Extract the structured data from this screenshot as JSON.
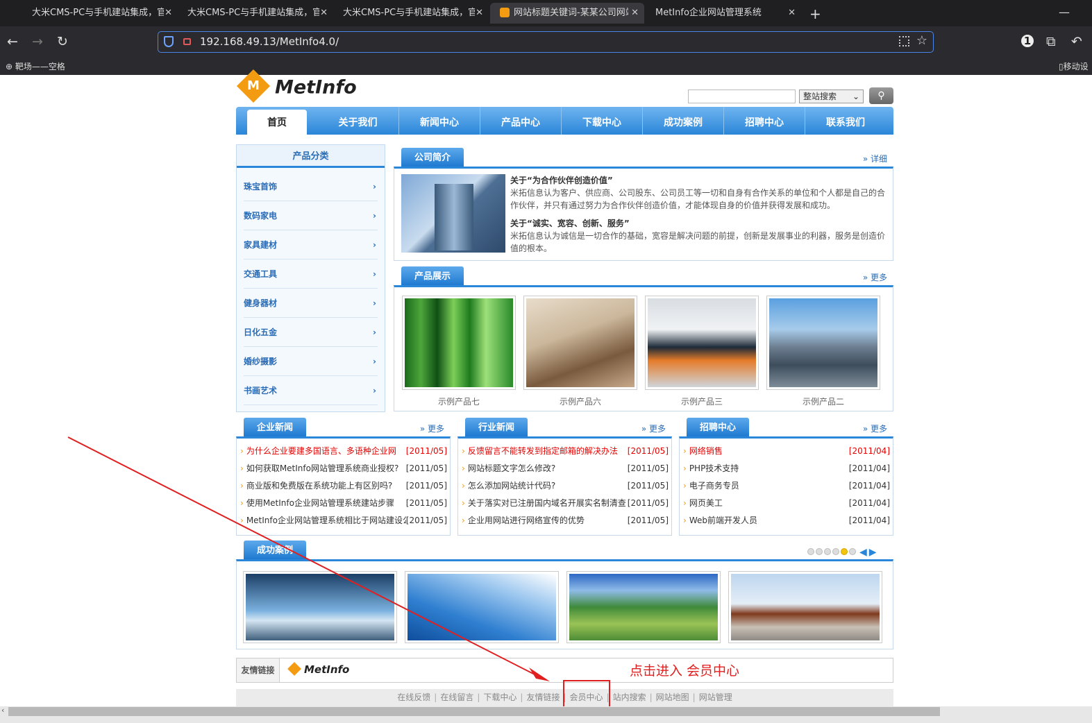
{
  "browser": {
    "tabs": [
      {
        "title": "大米CMS-PC与手机建站集成，官网"
      },
      {
        "title": "大米CMS-PC与手机建站集成，官网"
      },
      {
        "title": "大米CMS-PC与手机建站集成，官网"
      },
      {
        "title": "网站标题关键词-某某公司网站"
      },
      {
        "title": "MetInfo企业网站管理系统"
      }
    ],
    "url": "192.168.49.13/MetInfo4.0/",
    "bookmark": "靶场——空格",
    "bookmark_right": "移动设"
  },
  "site": {
    "logo_text": "MetInfo",
    "logo_letter": "M",
    "search_select": "整站搜索",
    "nav": [
      "首页",
      "关于我们",
      "新闻中心",
      "产品中心",
      "下载中心",
      "成功案例",
      "招聘中心",
      "联系我们"
    ],
    "sidebar": {
      "title": "产品分类",
      "items": [
        "珠宝首饰",
        "数码家电",
        "家具建材",
        "交通工具",
        "健身器材",
        "日化五金",
        "婚纱摄影",
        "书画艺术"
      ]
    },
    "intro": {
      "tab": "公司简介",
      "more": "详细",
      "h1": "关于“为合作伙伴创造价值”",
      "p1": "米拓信息认为客户、供应商、公司股东、公司员工等一切和自身有合作关系的单位和个人都是自己的合作伙伴，并只有通过努力为合作伙伴创造价值，才能体现自身的价值并获得发展和成功。",
      "h2": "关于“诚实、宽容、创新、服务”",
      "p2": "米拓信息认为诚信是一切合作的基础，宽容是解决问题的前提，创新是发展事业的利器，服务是创造价值的根本。"
    },
    "products": {
      "tab": "产品展示",
      "more": "更多",
      "items": [
        "示例产品七",
        "示例产品六",
        "示例产品三",
        "示例产品二"
      ]
    },
    "news_company": {
      "tab": "企业新闻",
      "more": "更多",
      "items": [
        {
          "title": "为什么企业要建多国语言、多语种企业网",
          "date": "[2011/05]",
          "hot": true
        },
        {
          "title": "如何获取MetInfo网站管理系统商业授权?",
          "date": "[2011/05]"
        },
        {
          "title": "商业版和免费版在系统功能上有区别吗?",
          "date": "[2011/05]"
        },
        {
          "title": "使用MetInfo企业网站管理系统建站步骤",
          "date": "[2011/05]"
        },
        {
          "title": "MetInfo企业网站管理系统相比于网站建设公",
          "date": "[2011/05]"
        }
      ]
    },
    "news_industry": {
      "tab": "行业新闻",
      "more": "更多",
      "items": [
        {
          "title": "反馈留言不能转发到指定邮箱的解决办法",
          "date": "[2011/05]",
          "hot": true
        },
        {
          "title": "网站标题文字怎么修改?",
          "date": "[2011/05]"
        },
        {
          "title": "怎么添加网站统计代码?",
          "date": "[2011/05]"
        },
        {
          "title": "关于落实对已注册国内域名开展实名制清查",
          "date": "[2011/05]"
        },
        {
          "title": "企业用网站进行网络宣传的优势",
          "date": "[2011/05]"
        }
      ]
    },
    "jobs": {
      "tab": "招聘中心",
      "more": "更多",
      "items": [
        {
          "title": "网络销售",
          "date": "[2011/04]",
          "hot": true
        },
        {
          "title": "PHP技术支持",
          "date": "[2011/04]"
        },
        {
          "title": "电子商务专员",
          "date": "[2011/04]"
        },
        {
          "title": "网页美工",
          "date": "[2011/04]"
        },
        {
          "title": "Web前端开发人员",
          "date": "[2011/04]"
        }
      ]
    },
    "cases": {
      "tab": "成功案例"
    },
    "links": {
      "label": "友情链接",
      "logo": "MetInfo"
    },
    "footer": [
      "在线反馈",
      "在线留言",
      "下载中心",
      "友情链接",
      "会员中心",
      "站内搜索",
      "网站地图",
      "网站管理"
    ]
  },
  "annotation": {
    "text": "点击进入  会员中心",
    "color": "#e02020"
  }
}
